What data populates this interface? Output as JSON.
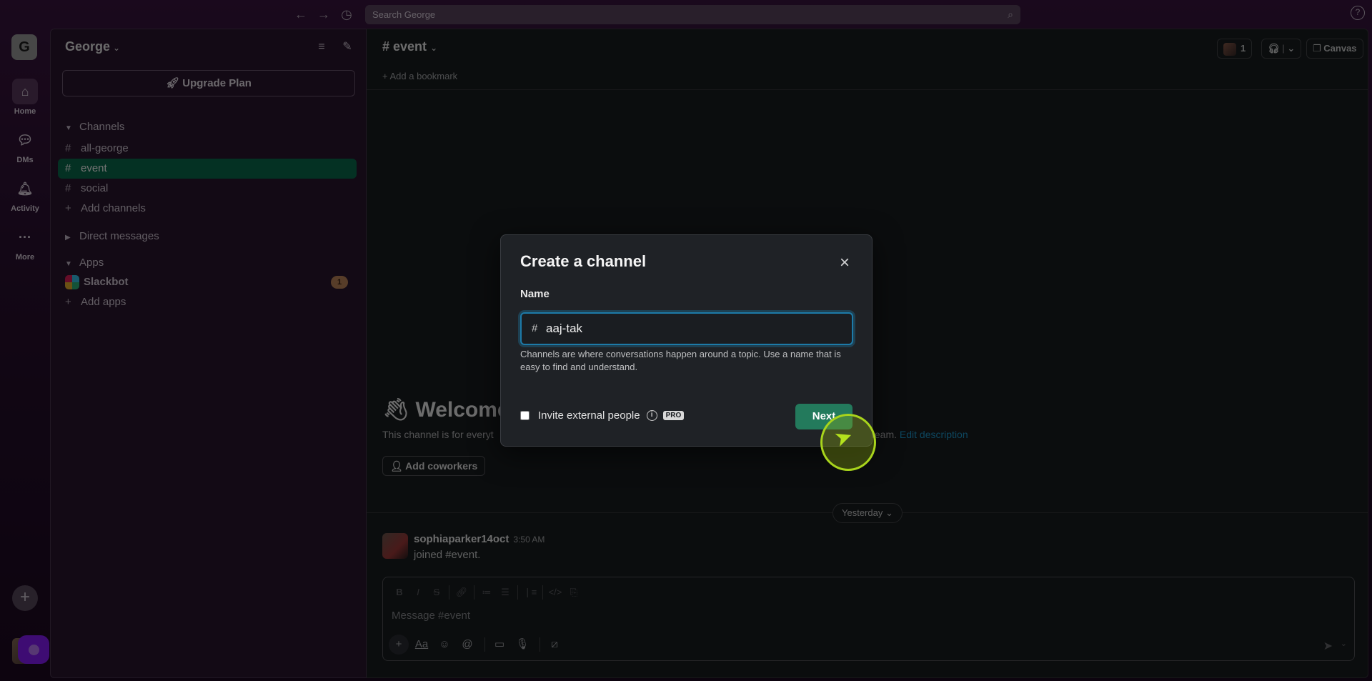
{
  "topbar": {
    "back_icon": "arrow-left-icon",
    "forward_icon": "arrow-right-icon",
    "history_icon": "clock-icon",
    "search_placeholder": "Search George",
    "help_icon": "question-circle-icon"
  },
  "rail": {
    "workspace_initial": "G",
    "items": [
      {
        "label": "Home",
        "icon": "home-icon",
        "active": true
      },
      {
        "label": "DMs",
        "icon": "dm-bubbles-icon"
      },
      {
        "label": "Activity",
        "icon": "bell-icon"
      },
      {
        "label": "More",
        "icon": "ellipsis-icon"
      }
    ],
    "add_icon": "plus-icon"
  },
  "sidebar": {
    "workspace_name": "George",
    "upgrade_label": "Upgrade Plan",
    "channels_header": "Channels",
    "channels": [
      {
        "name": "all-george"
      },
      {
        "name": "event",
        "active": true
      },
      {
        "name": "social"
      }
    ],
    "add_channels": "Add channels",
    "dm_header": "Direct messages",
    "apps_header": "Apps",
    "apps": [
      {
        "name": "Slackbot",
        "badge": "1"
      }
    ],
    "add_apps": "Add apps"
  },
  "main": {
    "channel_title": "# event",
    "add_bookmark": "Add a bookmark",
    "member_count": "1",
    "canvas_label": "Canvas",
    "welcome_title": "Welcome",
    "welcome_desc_left": "This channel is for everyt",
    "welcome_desc_right": "team.",
    "edit_description": "Edit description",
    "add_coworkers": "Add coworkers",
    "date_divider": "Yesterday",
    "messages": [
      {
        "author": "sophiaparker14oct",
        "time": "3:50 AM",
        "text": "joined #event."
      }
    ],
    "composer_placeholder": "Message #event"
  },
  "modal": {
    "title": "Create a channel",
    "name_label": "Name",
    "name_value": "aaj-tak",
    "help_text": "Channels are where conversations happen around a topic. Use a name that is easy to find and understand.",
    "invite_label": "Invite external people",
    "invite_checked": false,
    "pro_badge": "PRO",
    "next_label": "Next"
  }
}
